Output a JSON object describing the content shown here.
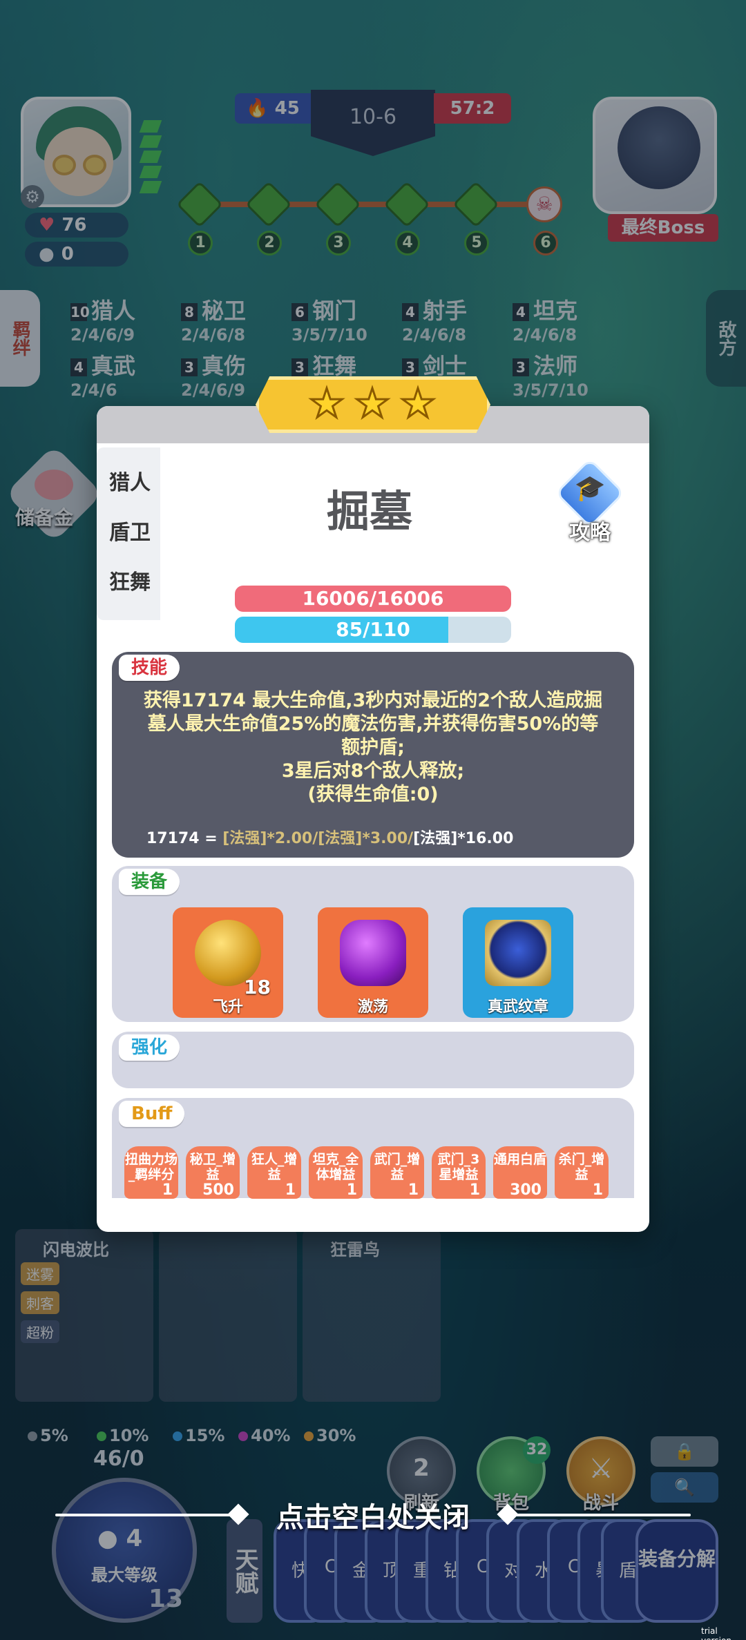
{
  "hud": {
    "hp": "76",
    "gold": "0",
    "score_left": "45",
    "round": "10-6",
    "score_right": "57:2",
    "stages": [
      "1",
      "2",
      "3",
      "4",
      "5",
      "6"
    ],
    "boss_label": "最终Boss",
    "left_tab": "羁绊",
    "right_tab": "敌方"
  },
  "synergies": [
    {
      "count": "10",
      "name": "猎人",
      "tiers": "2/4/6/9"
    },
    {
      "count": "8",
      "name": "秘卫",
      "tiers": "2/4/6/8"
    },
    {
      "count": "6",
      "name": "钢门",
      "tiers": "3/5/7/10"
    },
    {
      "count": "4",
      "name": "射手",
      "tiers": "2/4/6/8"
    },
    {
      "count": "4",
      "name": "坦克",
      "tiers": "2/4/6/8"
    },
    {
      "count": "4",
      "name": "真武",
      "tiers": "2/4/6"
    },
    {
      "count": "3",
      "name": "真伤",
      "tiers": "2/4/6/9"
    },
    {
      "count": "3",
      "name": "狂舞",
      "tiers": ""
    },
    {
      "count": "3",
      "name": "剑士",
      "tiers": ""
    },
    {
      "count": "3",
      "name": "法师",
      "tiers": "3/5/7/10"
    }
  ],
  "piggy_label": "储备金",
  "modal": {
    "stars": 3,
    "tabs": [
      "猎人",
      "盾卫",
      "狂舞"
    ],
    "hero_name": "掘墓",
    "guide_label": "攻略",
    "hp_text": "16006/16006",
    "mp_text": "85/110",
    "mp_fraction": 0.773,
    "skill_tag": "技能",
    "skill_lines": [
      "获得17174 最大生命值,3秒内对最近的2个敌人造成掘",
      "墓人最大生命值25%的魔法伤害,并获得伤害50%的等",
      "额护盾;",
      "3星后对8个敌人释放;",
      "(获得生命值:0)"
    ],
    "formula_value": "17174 = ",
    "formula_part1": "[法强]*2.00/[法强]*3.00/",
    "formula_part2": "[法强]*16.00",
    "equip_tag": "装备",
    "equipment": [
      {
        "name": "飞升",
        "count": "18",
        "color": "#f0723f",
        "icon": "golden-orb-icon"
      },
      {
        "name": "激荡",
        "count": "",
        "color": "#f0723f",
        "icon": "purple-gem-icon"
      },
      {
        "name": "真武纹章",
        "count": "",
        "color": "#2aa2dd",
        "icon": "crest-icon"
      }
    ],
    "boost_tag": "强化",
    "buff_tag": "Buff",
    "buffs": [
      {
        "name": "扭曲力场_羁绊分",
        "value": "1"
      },
      {
        "name": "秘卫_增益",
        "value": "500"
      },
      {
        "name": "狂人_增益",
        "value": "1"
      },
      {
        "name": "坦克_全体增益",
        "value": "1"
      },
      {
        "name": "武门_增益",
        "value": "1"
      },
      {
        "name": "武门_3星增益",
        "value": "1"
      },
      {
        "name": "通用白盾",
        "value": "300"
      },
      {
        "name": "杀门_增益",
        "value": "1"
      }
    ]
  },
  "bottom": {
    "cards": [
      "闪电波比",
      "",
      "狂雷鸟"
    ],
    "card_tags": [
      "迷雾",
      "刺客",
      "超粉"
    ],
    "odds": [
      {
        "value": "5%",
        "color": "#9aa4ad"
      },
      {
        "value": "10%",
        "color": "#4fd15a"
      },
      {
        "value": "15%",
        "color": "#3aa7f0"
      },
      {
        "value": "40%",
        "color": "#d248c9"
      },
      {
        "value": "30%",
        "color": "#f2a73a"
      }
    ],
    "exp": "46/0",
    "level_cost": "4",
    "level_label": "最大等级",
    "level": "13",
    "refresh_label": "刷新",
    "refresh_cost": "2",
    "bag_label": "背包",
    "bag_count": "32",
    "fight_label": "战斗",
    "close_hint": "点击空白处关闭",
    "talent_label": "天赋",
    "chips": [
      "快",
      "C",
      "金",
      "顶",
      "重",
      "钻",
      "C",
      "对",
      "水",
      "C",
      "暴",
      "盾"
    ],
    "split_label": "装备分解",
    "trial": "trial version"
  }
}
